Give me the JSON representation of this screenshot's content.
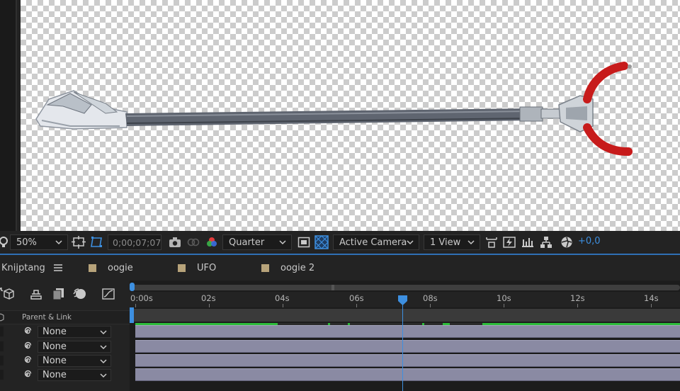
{
  "viewer_toolbar": {
    "zoom": "50%",
    "timecode": "0;00;07;07",
    "resolution": "Quarter",
    "camera": "Active Camera",
    "views": "1 View",
    "exposure": "+0,0"
  },
  "tabs": [
    {
      "label": "Knijptang",
      "active": true
    },
    {
      "label": "oogie",
      "color": "#b7a37a"
    },
    {
      "label": "UFO",
      "color": "#b7a37a"
    },
    {
      "label": "oogie 2",
      "color": "#b7a37a"
    }
  ],
  "timeline": {
    "column_header": "Parent & Link",
    "layers": [
      {
        "parent": "None"
      },
      {
        "parent": "None"
      },
      {
        "parent": "None"
      },
      {
        "parent": "None"
      }
    ],
    "ruler_labels": [
      "0:00s",
      "02s",
      "04s",
      "06s",
      "08s",
      "10s",
      "12s",
      "14s"
    ],
    "playhead_seconds": 7.23,
    "accent": "#3d8fe0",
    "layer_bar_color": "#8a8aa3"
  }
}
